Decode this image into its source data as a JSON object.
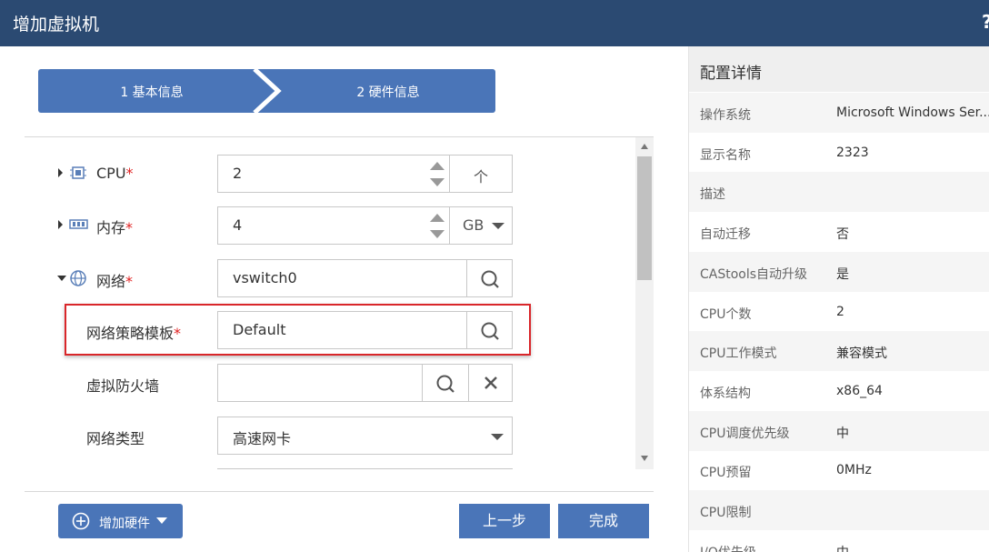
{
  "window": {
    "title": "增加虚拟机",
    "help": "?"
  },
  "steps": [
    {
      "label": "1 基本信息"
    },
    {
      "label": "2 硬件信息"
    }
  ],
  "form": {
    "cpu": {
      "label": "CPU",
      "value": "2",
      "unit": "个"
    },
    "memory": {
      "label": "内存",
      "value": "4",
      "unit": "GB"
    },
    "network": {
      "label": "网络",
      "value": "vswitch0"
    },
    "policy_template": {
      "label": "网络策略模板",
      "value": "Default"
    },
    "virtual_firewall": {
      "label": "虚拟防火墙",
      "value": ""
    },
    "network_type": {
      "label": "网络类型",
      "value": "高速网卡"
    },
    "required_mark": "*"
  },
  "footer": {
    "add_hardware_label": "增加硬件",
    "prev_label": "上一步",
    "finish_label": "完成"
  },
  "details": {
    "title": "配置详情",
    "rows": [
      {
        "key": "操作系统",
        "value": "Microsoft Windows Ser..."
      },
      {
        "key": "显示名称",
        "value": "2323"
      },
      {
        "key": "描述",
        "value": ""
      },
      {
        "key": "自动迁移",
        "value": "否"
      },
      {
        "key": "CAStools自动升级",
        "value": "是"
      },
      {
        "key": "CPU个数",
        "value": "2"
      },
      {
        "key": "CPU工作模式",
        "value": "兼容模式"
      },
      {
        "key": "体系结构",
        "value": "x86_64"
      },
      {
        "key": "CPU调度优先级",
        "value": "中"
      },
      {
        "key": "CPU预留",
        "value": "0MHz"
      },
      {
        "key": "CPU限制",
        "value": ""
      },
      {
        "key": "I/O优先级",
        "value": "中"
      }
    ]
  },
  "colors": {
    "titlebar": "#2b4a72",
    "accent": "#4a75b8",
    "highlight_border": "#d9262a",
    "required": "#e02020"
  },
  "icons": {
    "cpu": "cpu-chip-icon",
    "memory": "memory-module-icon",
    "network": "globe-icon",
    "search": "search-icon",
    "clear": "close-icon",
    "add": "plus-circle-icon"
  }
}
